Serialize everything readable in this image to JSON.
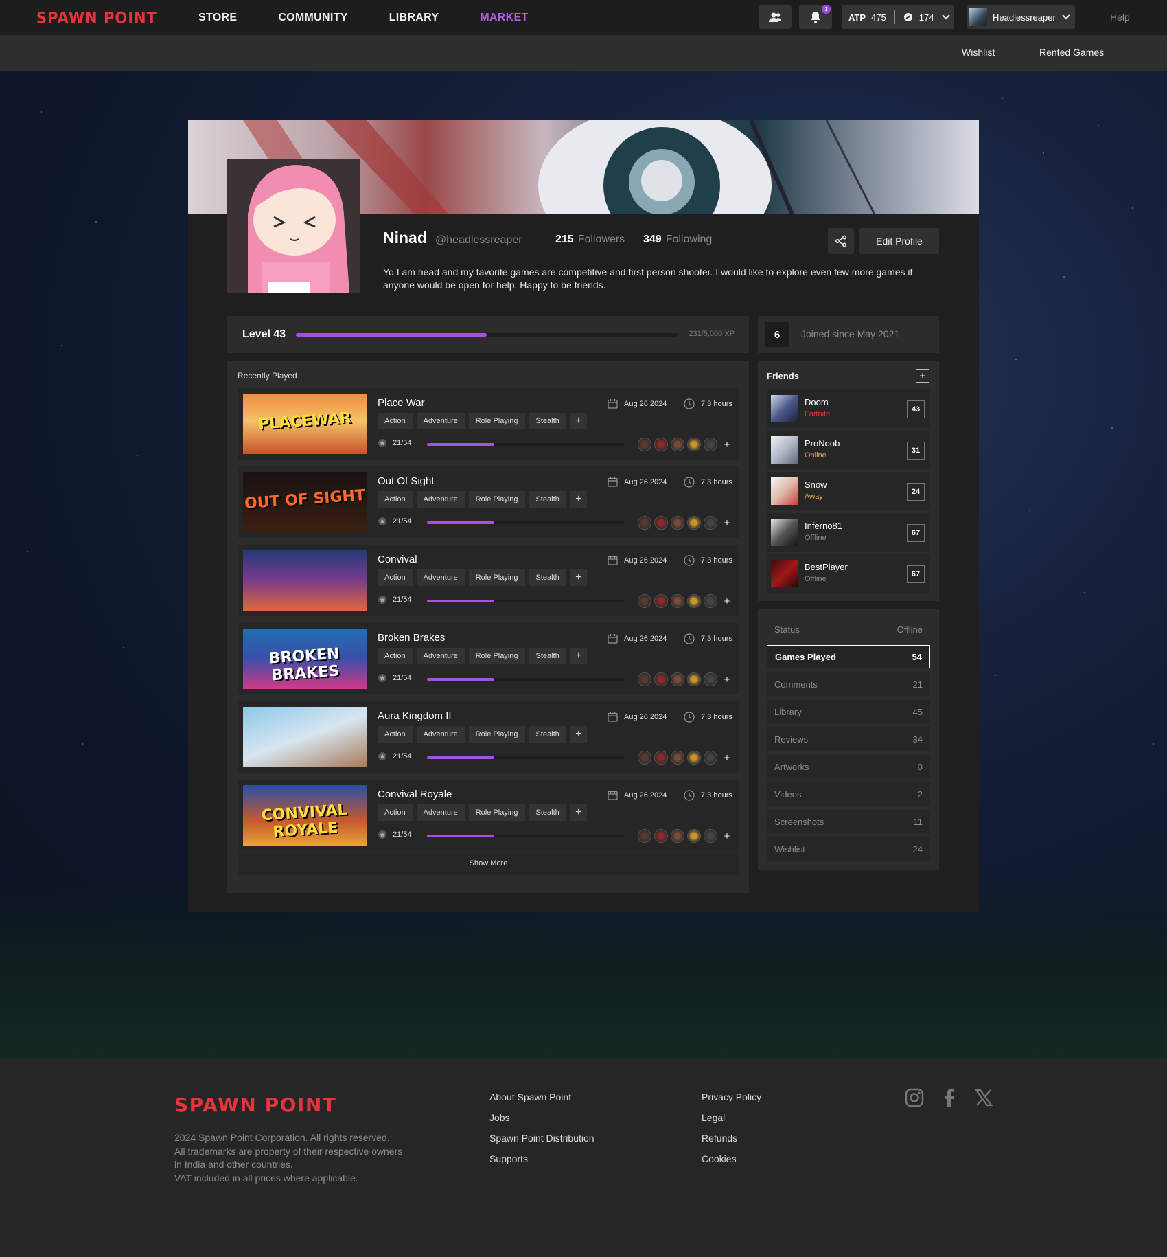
{
  "brand": {
    "name": "SPAWN POINT",
    "accent": "#e8323c",
    "purple": "#a851e0"
  },
  "nav": {
    "items": [
      "STORE",
      "COMMUNITY",
      "LIBRARY",
      "MARKET"
    ],
    "active": "MARKET"
  },
  "topbar": {
    "notifications": "1",
    "atp_label": "ATP",
    "atp_value": "475",
    "coins": "174",
    "username": "Headlessreaper",
    "help": "Help"
  },
  "subnav": {
    "wishlist": "Wishlist",
    "rented": "Rented Games"
  },
  "profile": {
    "name": "Ninad",
    "handle": "@headlessreaper",
    "followers_count": "215",
    "followers_label": "Followers",
    "following_count": "349",
    "following_label": "Following",
    "edit_label": "Edit Profile",
    "bio": "Yo I am head and my favorite games are competitive and first person shooter. I would like to explore even few more games if anyone would be open for help. Happy to be friends."
  },
  "level": {
    "label": "Level 43",
    "xp_text": "231/5,000 XP",
    "progress": 0.5
  },
  "joined": {
    "badge": "6",
    "text": "Joined since May 2021"
  },
  "recent": {
    "heading": "Recently Played",
    "tags": [
      "Action",
      "Adventure",
      "Role Playing",
      "Stealth"
    ],
    "games": [
      {
        "title": "Place War",
        "date": "Aug 26 2024",
        "hours": "7.3 hours",
        "achievements": "21/54",
        "thumb_text": "PLACEWAR"
      },
      {
        "title": "Out Of Sight",
        "date": "Aug 26 2024",
        "hours": "7.3 hours",
        "achievements": "21/54",
        "thumb_text": "OUT OF SIGHT"
      },
      {
        "title": "Convival",
        "date": "Aug 26 2024",
        "hours": "7.3 hours",
        "achievements": "21/54",
        "thumb_text": ""
      },
      {
        "title": "Broken Brakes",
        "date": "Aug 26 2024",
        "hours": "7.3 hours",
        "achievements": "21/54",
        "thumb_text": "BROKEN BRAKES"
      },
      {
        "title": "Aura Kingdom II",
        "date": "Aug 26 2024",
        "hours": "7.3 hours",
        "achievements": "21/54",
        "thumb_text": ""
      },
      {
        "title": "Convival Royale",
        "date": "Aug 26 2024",
        "hours": "7.3 hours",
        "achievements": "21/54",
        "thumb_text": "CONVIVAL ROYALE"
      }
    ],
    "show_more": "Show More"
  },
  "friends": {
    "heading": "Friends",
    "list": [
      {
        "name": "Doom",
        "status": "Fortnite",
        "status_color": "#e8323c",
        "level": "43"
      },
      {
        "name": "ProNoob",
        "status": "Online",
        "status_color": "#d6b25a",
        "level": "31"
      },
      {
        "name": "Snow",
        "status": "Away",
        "status_color": "#e8b24a",
        "level": "24"
      },
      {
        "name": "Inferno81",
        "status": "Offline",
        "status_color": "#8c8c8c",
        "level": "67"
      },
      {
        "name": "BestPlayer",
        "status": "Offline",
        "status_color": "#8c8c8c",
        "level": "67"
      }
    ]
  },
  "stats": {
    "rows": [
      {
        "label": "Status",
        "value": "Offline"
      },
      {
        "label": "Games Played",
        "value": "54"
      },
      {
        "label": "Comments",
        "value": "21"
      },
      {
        "label": "Library",
        "value": "45"
      },
      {
        "label": "Reviews",
        "value": "34"
      },
      {
        "label": "Artworks",
        "value": "0"
      },
      {
        "label": "Videos",
        "value": "2"
      },
      {
        "label": "Screenshots",
        "value": "11"
      },
      {
        "label": "Wishlist",
        "value": "24"
      }
    ]
  },
  "footer": {
    "logo": "SPAWN POINT",
    "copy1": "2024 Spawn Point Corporation. All rights reserved.",
    "copy2": "All trademarks are property of their respective owners in India and other countries.",
    "copy3": "VAT included in all prices where applicable.",
    "col1": [
      "About Spawn Point",
      "Jobs",
      "Spawn Point Distribution",
      "Supports"
    ],
    "col2": [
      "Privacy Policy",
      "Legal",
      "Refunds",
      "Cookies"
    ]
  }
}
